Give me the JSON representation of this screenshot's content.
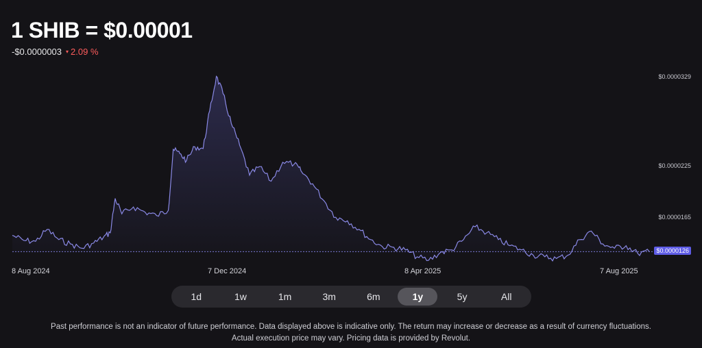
{
  "header": {
    "title": "1 SHIB = $0.00001",
    "change_abs": "-$0.0000003",
    "change_pct": "2.09 %",
    "change_arrow": "▾"
  },
  "colors": {
    "line": "#7b7ad6",
    "negative": "#ff5c5c",
    "current_badge": "#5e5ce6"
  },
  "chart_data": {
    "type": "area",
    "y_axis_labels": [
      "$0.0000329",
      "$0.0000225",
      "$0.0000165"
    ],
    "y_axis_values": [
      3.29e-05,
      2.25e-05,
      1.65e-05
    ],
    "current_value_label": "$0.0000126",
    "current_value": 1.26e-05,
    "x_axis_labels": [
      "8 Aug 2024",
      "7 Dec 2024",
      "8 Apr 2025",
      "7 Aug 2025"
    ],
    "x_range": [
      "2024-08-07",
      "2025-08-28"
    ],
    "ylim": [
      1.08e-05,
      3.55e-05
    ],
    "points": [
      [
        "2024-08-07",
        1.45e-05
      ],
      [
        "2024-08-14",
        1.39e-05
      ],
      [
        "2024-08-21",
        1.38e-05
      ],
      [
        "2024-08-28",
        1.52e-05
      ],
      [
        "2024-09-04",
        1.4e-05
      ],
      [
        "2024-09-11",
        1.35e-05
      ],
      [
        "2024-09-18",
        1.3e-05
      ],
      [
        "2024-09-25",
        1.36e-05
      ],
      [
        "2024-10-01",
        1.43e-05
      ],
      [
        "2024-10-05",
        1.48e-05
      ],
      [
        "2024-10-08",
        1.88e-05
      ],
      [
        "2024-10-12",
        1.7e-05
      ],
      [
        "2024-10-19",
        1.78e-05
      ],
      [
        "2024-10-26",
        1.72e-05
      ],
      [
        "2024-11-02",
        1.68e-05
      ],
      [
        "2024-11-09",
        1.74e-05
      ],
      [
        "2024-11-12",
        2.45e-05
      ],
      [
        "2024-11-16",
        2.4e-05
      ],
      [
        "2024-11-20",
        2.32e-05
      ],
      [
        "2024-11-25",
        2.48e-05
      ],
      [
        "2024-11-30",
        2.46e-05
      ],
      [
        "2024-12-04",
        2.9e-05
      ],
      [
        "2024-12-08",
        3.3e-05
      ],
      [
        "2024-12-12",
        3.1e-05
      ],
      [
        "2024-12-17",
        2.75e-05
      ],
      [
        "2024-12-22",
        2.5e-05
      ],
      [
        "2024-12-28",
        2.15e-05
      ],
      [
        "2025-01-03",
        2.25e-05
      ],
      [
        "2025-01-10",
        2.08e-05
      ],
      [
        "2025-01-17",
        2.3e-05
      ],
      [
        "2025-01-24",
        2.28e-05
      ],
      [
        "2025-01-28",
        2.2e-05
      ],
      [
        "2025-02-04",
        2.05e-05
      ],
      [
        "2025-02-11",
        1.85e-05
      ],
      [
        "2025-02-18",
        1.66e-05
      ],
      [
        "2025-02-25",
        1.62e-05
      ],
      [
        "2025-03-04",
        1.52e-05
      ],
      [
        "2025-03-11",
        1.4e-05
      ],
      [
        "2025-03-18",
        1.32e-05
      ],
      [
        "2025-03-25",
        1.31e-05
      ],
      [
        "2025-04-01",
        1.28e-05
      ],
      [
        "2025-04-08",
        1.2e-05
      ],
      [
        "2025-04-15",
        1.16e-05
      ],
      [
        "2025-04-22",
        1.25e-05
      ],
      [
        "2025-04-29",
        1.28e-05
      ],
      [
        "2025-05-06",
        1.4e-05
      ],
      [
        "2025-05-13",
        1.55e-05
      ],
      [
        "2025-05-20",
        1.48e-05
      ],
      [
        "2025-05-27",
        1.4e-05
      ],
      [
        "2025-06-03",
        1.33e-05
      ],
      [
        "2025-06-10",
        1.28e-05
      ],
      [
        "2025-06-17",
        1.22e-05
      ],
      [
        "2025-06-24",
        1.2e-05
      ],
      [
        "2025-07-01",
        1.18e-05
      ],
      [
        "2025-07-08",
        1.22e-05
      ],
      [
        "2025-07-15",
        1.4e-05
      ],
      [
        "2025-07-22",
        1.5e-05
      ],
      [
        "2025-07-29",
        1.35e-05
      ],
      [
        "2025-08-05",
        1.3e-05
      ],
      [
        "2025-08-12",
        1.33e-05
      ],
      [
        "2025-08-19",
        1.24e-05
      ],
      [
        "2025-08-26",
        1.26e-05
      ]
    ]
  },
  "timeframes": {
    "items": [
      "1d",
      "1w",
      "1m",
      "3m",
      "6m",
      "1y",
      "5y",
      "All"
    ],
    "active": "1y"
  },
  "disclaimer": {
    "line1": "Past performance is not an indicator of future performance. Data displayed above is indicative only. The return may increase or decrease as a result of currency fluctuations.",
    "line2": "Actual execution price may vary. Pricing data is provided by Revolut."
  }
}
